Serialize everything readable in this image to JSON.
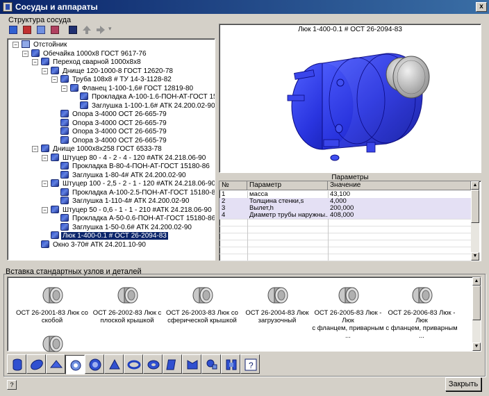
{
  "window": {
    "title": "Сосуды и аппараты",
    "close": "x"
  },
  "structure_label": "Структура сосуда",
  "toolbar": {
    "icons": [
      "add-part-icon",
      "delete-part-icon",
      "copy-part-icon",
      "paste-part-icon",
      "save-icon",
      "move-up-icon",
      "move-right-icon",
      "dropdown-arrow-icon"
    ],
    "dropdown_glyph": "▾"
  },
  "tree": [
    {
      "label": "Отстойник",
      "level": 0,
      "expander": "−",
      "root": true
    },
    {
      "label": "Обечайка 1000x8 ГОСТ 9617-76",
      "level": 1,
      "expander": "−"
    },
    {
      "label": "Переход сварной 1000x8x8",
      "level": 2,
      "expander": "−"
    },
    {
      "label": "Днище 120-1000-8 ГОСТ 12620-78",
      "level": 3,
      "expander": "−"
    },
    {
      "label": "Труба 108x8 # ТУ 14-3-1128-82",
      "level": 4,
      "expander": "−"
    },
    {
      "label": "Фланец 1-100-1,6# ГОСТ 12819-80",
      "level": 5,
      "expander": "−"
    },
    {
      "label": "Прокладка А-100-1.6-ПОН-АТ-ГОСТ 15180-86",
      "level": 6
    },
    {
      "label": "Заглушка 1-100-1.6# АТК 24.200.02-90",
      "level": 6
    },
    {
      "label": "Опора 3-4000 ОСТ 26-665-79",
      "level": 4
    },
    {
      "label": "Опора 3-4000 ОСТ 26-665-79",
      "level": 4
    },
    {
      "label": "Опора 3-4000 ОСТ 26-665-79",
      "level": 4
    },
    {
      "label": "Опора 3-4000 ОСТ 26-665-79",
      "level": 4
    },
    {
      "label": "Днище 1000x8x258 ГОСТ 6533-78",
      "level": 2,
      "expander": "−"
    },
    {
      "label": "Штуцер 80 - 4 - 2 - 4 - 120 #АТК 24.218.06-90",
      "level": 3,
      "expander": "−"
    },
    {
      "label": "Прокладка В-80-4-ПОН-АТ-ГОСТ 15180-86",
      "level": 4
    },
    {
      "label": "Заглушка 1-80-4# АТК 24.200.02-90",
      "level": 4
    },
    {
      "label": "Штуцер 100 - 2,5 - 2 - 1 - 120 #АТК 24.218.06-90",
      "level": 3,
      "expander": "−"
    },
    {
      "label": "Прокладка А-100-2.5-ПОН-АТ-ГОСТ 15180-86",
      "level": 4
    },
    {
      "label": "Заглушка 1-110-4# АТК 24.200.02-90",
      "level": 4
    },
    {
      "label": "Штуцер 50 - 0,6 - 1 - 1 - 210 #АТК 24.218.06-90",
      "level": 3,
      "expander": "−"
    },
    {
      "label": "Прокладка А-50-0.6-ПОН-АТ-ГОСТ 15180-86",
      "level": 4
    },
    {
      "label": "Заглушка 1-50-0.6# АТК 24.200.02-90",
      "level": 4
    },
    {
      "label": "Люк 1-400-0.1 # ОСТ 26-2094-83",
      "level": 3,
      "selected": true
    },
    {
      "label": "Окно 3-70# АТК 24.201.10-90",
      "level": 2
    }
  ],
  "preview": {
    "caption": "Люк 1-400-0.1 # ОСТ 26-2094-83"
  },
  "params": {
    "caption": "Параметры",
    "columns": [
      "№",
      "Параметр",
      "Значение"
    ],
    "rows": [
      {
        "n": "1",
        "name": "масса",
        "value": "43,100"
      },
      {
        "n": "2",
        "name": "Толщина стенки,s",
        "value": "4,000"
      },
      {
        "n": "3",
        "name": "Вылет,h",
        "value": "200,000"
      },
      {
        "n": "4",
        "name": "Диаметр трубы наружны...",
        "value": "408,000"
      }
    ]
  },
  "catalog": {
    "label": "Вставка стандартных узлов и деталей",
    "items": [
      {
        "line1": "ОСТ 26-2001-83 Люк со",
        "line2": "скобой"
      },
      {
        "line1": "ОСТ 26-2002-83 Люк с",
        "line2": "плоской крышкой"
      },
      {
        "line1": "ОСТ 26-2003-83 Люк со",
        "line2": "сферической крышкой"
      },
      {
        "line1": "ОСТ 26-2004-83 Люк",
        "line2": "загрузочный"
      },
      {
        "line1": "ОСТ 26-2005-83 Люк - Люк",
        "line2": "с фланцем, приварным ..."
      },
      {
        "line1": "ОСТ 26-2006-83 Люк - Люк",
        "line2": "с фланцем, приварным ..."
      },
      {
        "line1": "",
        "line2": ""
      }
    ]
  },
  "tabs": [
    "shell-tab",
    "bottom-tab",
    "cone-tab",
    "nozzle-tab",
    "flange-tab",
    "support-tab",
    "ring-tab",
    "gasket-tab",
    "plate-tab",
    "bracket-tab",
    "fitting-tab",
    "assembly-tab",
    "help-tab"
  ],
  "buttons": {
    "help": "?",
    "close": "Закрыть"
  },
  "scroll": {
    "up": "▲",
    "down": "▼"
  },
  "colors": {
    "title_bar": "#0a246a",
    "vessel": "#2a35e0",
    "selection": "#0a246a",
    "row_highlight": "#e4e0f4"
  }
}
